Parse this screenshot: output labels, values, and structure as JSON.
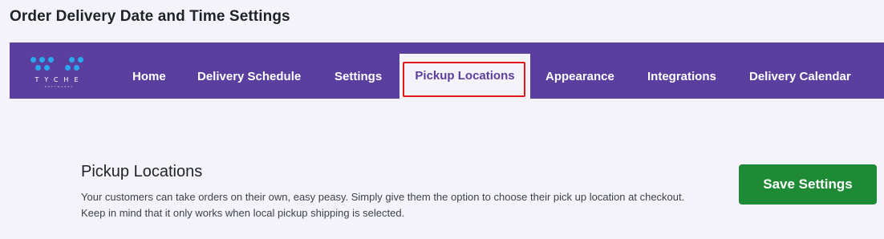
{
  "page": {
    "title": "Order Delivery Date and Time Settings"
  },
  "brand": {
    "name": "TYCHE",
    "tagline": "SOFTWARES",
    "logo_color": "#27a8ef"
  },
  "nav": {
    "background": "#5b3f9e",
    "items": [
      {
        "label": "Home",
        "active": false
      },
      {
        "label": "Delivery Schedule",
        "active": false
      },
      {
        "label": "Settings",
        "active": false
      },
      {
        "label": "Pickup Locations",
        "active": true
      },
      {
        "label": "Appearance",
        "active": false
      },
      {
        "label": "Integrations",
        "active": false
      },
      {
        "label": "Delivery Calendar",
        "active": false
      }
    ]
  },
  "section": {
    "title": "Pickup Locations",
    "description": "Your customers can take orders on their own, easy peasy. Simply give them the option to choose their pick up location at checkout. Keep in mind that it only works when local pickup shipping is selected."
  },
  "actions": {
    "save_label": "Save Settings",
    "save_color": "#1f8a35"
  }
}
